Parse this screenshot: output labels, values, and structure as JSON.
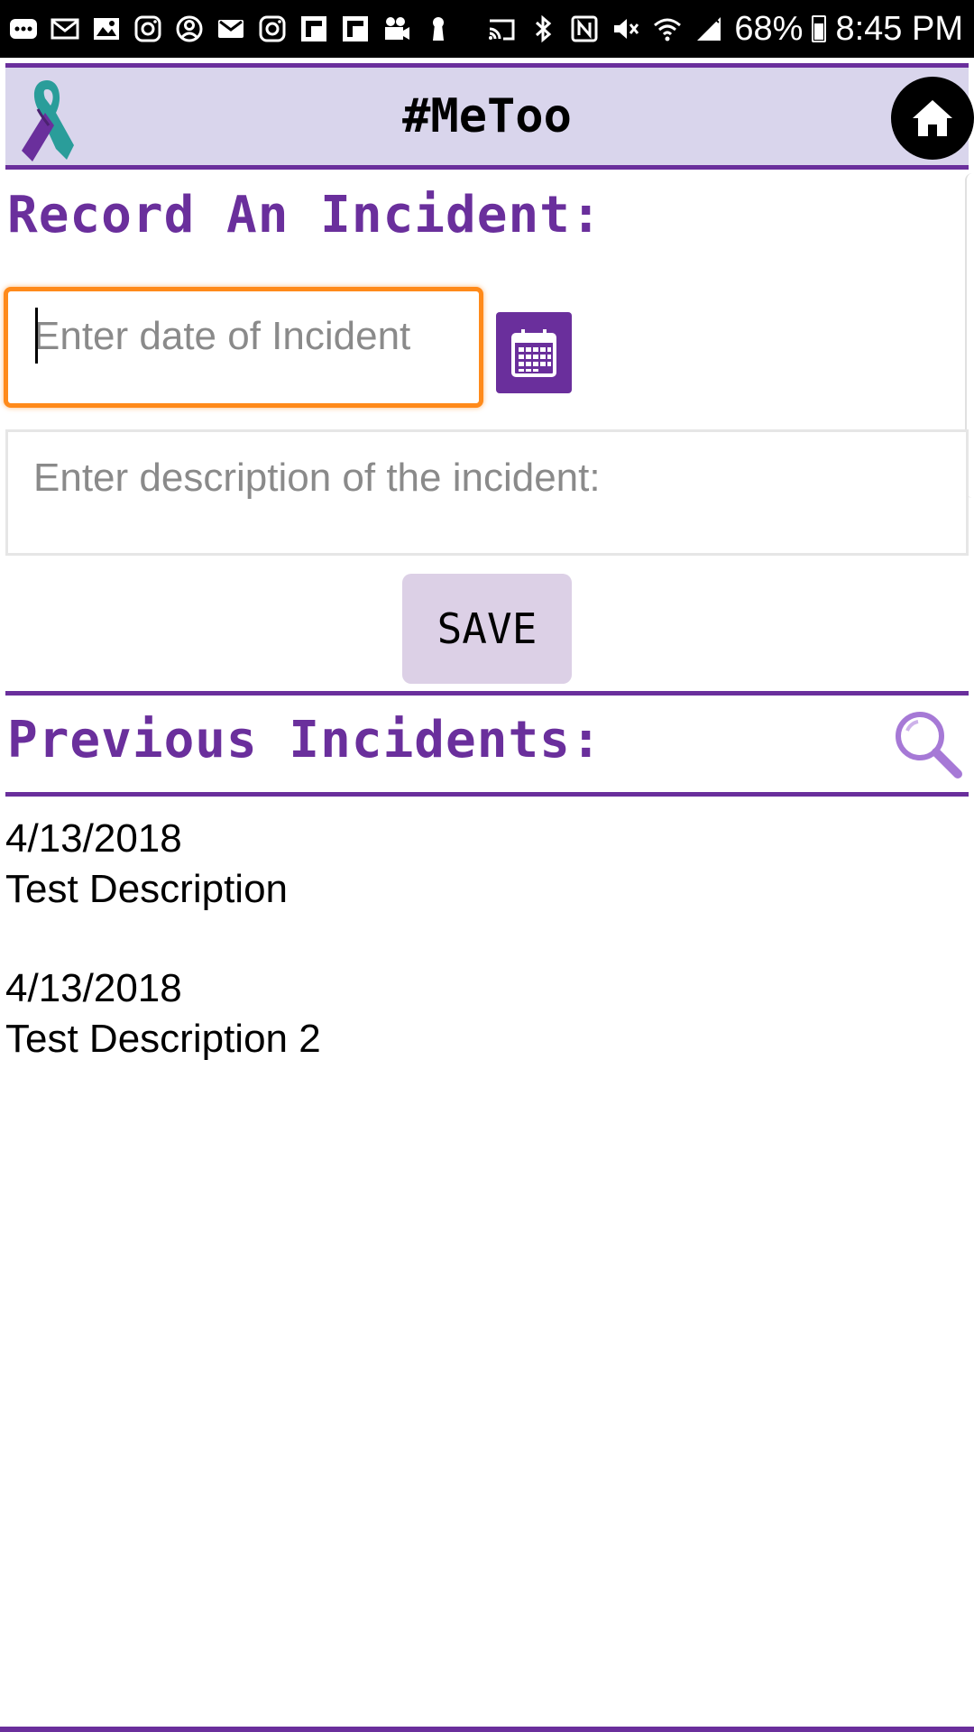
{
  "status_bar": {
    "icons": [
      "messages-icon",
      "gmail-icon",
      "gallery-icon",
      "instagram-icon",
      "account-icon",
      "email-icon",
      "instagram-icon",
      "flipboard-icon",
      "flipboard-icon",
      "video-icon",
      "keyhole-icon"
    ],
    "right_icons": [
      "cast-icon",
      "bluetooth-icon",
      "nfc-icon",
      "mute-icon",
      "wifi-icon",
      "signal-icon"
    ],
    "battery": "68%",
    "time": "8:45 PM"
  },
  "header": {
    "title": "#MeToo",
    "logo": "awareness-ribbon-logo",
    "home_icon": "home-icon"
  },
  "record": {
    "title": "Record An Incident:",
    "date_placeholder": "Enter date of Incident",
    "date_value": "",
    "calendar_icon": "calendar-icon",
    "description_placeholder": "Enter description of the incident:",
    "description_value": "",
    "save_label": "SAVE"
  },
  "previous": {
    "title": "Previous Incidents:",
    "search_icon": "search-icon",
    "items": [
      {
        "date": "4/13/2018",
        "description": "Test Description"
      },
      {
        "date": "4/13/2018",
        "description": "Test Description 2"
      }
    ]
  },
  "colors": {
    "accent": "#6a2f9c",
    "header_bg": "#d9d5ec",
    "focus": "#ff8a1a",
    "button_bg": "#dcd0e6"
  }
}
